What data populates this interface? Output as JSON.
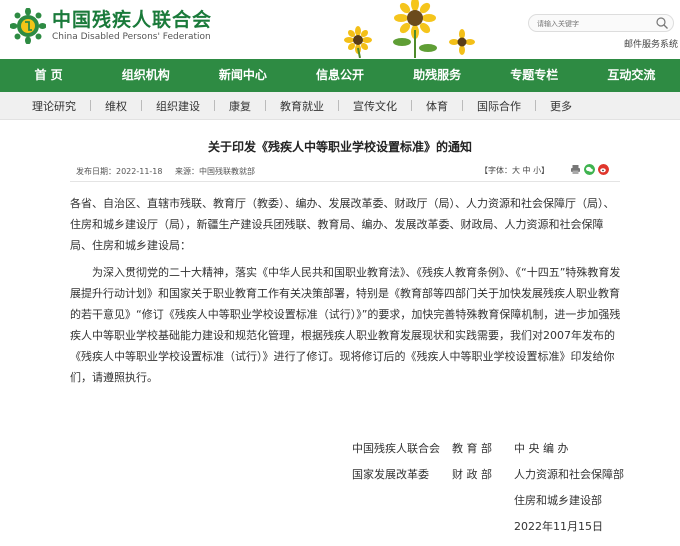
{
  "header": {
    "logo_cn": "中国残疾人联合会",
    "logo_en": "China Disabled Persons' Federation",
    "search_placeholder": "请输入关键字",
    "mail_link": "邮件服务系统"
  },
  "main_nav": [
    "首 页",
    "组织机构",
    "新闻中心",
    "信息公开",
    "助残服务",
    "专题专栏",
    "互动交流"
  ],
  "sub_nav": [
    "理论研究",
    "维权",
    "组织建设",
    "康复",
    "教育就业",
    "宣传文化",
    "体育",
    "国际合作",
    "更多"
  ],
  "article": {
    "title": "关于印发《残疾人中等职业学校设置标准》的通知",
    "date": "发布日期：2022-11-18",
    "source": "来源：中国残联教就部",
    "font_ctl": "【字体：大 中 小】",
    "para1": "各省、自治区、直辖市残联、教育厅（教委）、编办、发展改革委、财政厅（局）、人力资源和社会保障厅（局）、住房和城乡建设厅（局），新疆生产建设兵团残联、教育局、编办、发展改革委、财政局、人力资源和社会保障局、住房和城乡建设局：",
    "para2": "为深入贯彻党的二十大精神，落实《中华人民共和国职业教育法》、《残疾人教育条例》、《“十四五”特殊教育发展提升行动计划》和国家关于职业教育工作有关决策部署，特别是《教育部等四部门关于加快发展残疾人职业教育的若干意见》“修订《残疾人中等职业学校设置标准（试行）》”的要求，加快完善特殊教育保障机制，进一步加强残疾人中等职业学校基础能力建设和规范化管理，根据残疾人职业教育发展现状和实践需要，我们对2007年发布的《残疾人中等职业学校设置标准（试行）》进行了修订。现将修订后的《残疾人中等职业学校设置标准》印发给你们，请遵照执行。"
  },
  "signatures": {
    "row1": [
      "中国残疾人联合会",
      "教 育 部",
      "中 央 编 办"
    ],
    "row2": [
      "国家发展改革委",
      "财 政 部",
      "人力资源和社会保障部"
    ],
    "row3": "住房和城乡建设部",
    "date": "2022年11月15日"
  },
  "colors": {
    "nav_green": "#2e8b43",
    "logo_green": "#1a7a3a"
  }
}
